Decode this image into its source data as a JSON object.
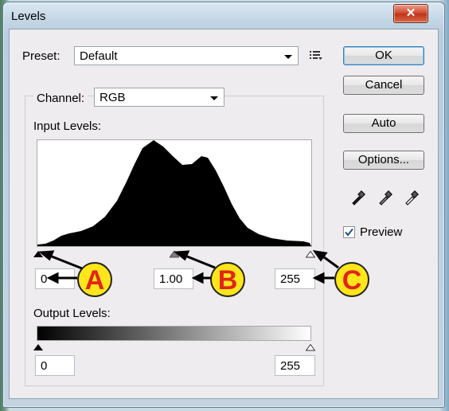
{
  "window": {
    "title": "Levels",
    "close_label": "✕"
  },
  "preset": {
    "label": "Preset:",
    "value": "Default",
    "menu_icon": "list-menu-icon"
  },
  "channel": {
    "label": "Channel:",
    "value": "RGB"
  },
  "input_levels": {
    "label": "Input Levels:",
    "black_point": "0",
    "gamma": "1.00",
    "white_point": "255"
  },
  "output_levels": {
    "label": "Output Levels:",
    "black_point": "0",
    "white_point": "255"
  },
  "buttons": {
    "ok": "OK",
    "cancel": "Cancel",
    "auto": "Auto",
    "options": "Options..."
  },
  "eyedroppers": [
    "black-eyedropper-icon",
    "gray-eyedropper-icon",
    "white-eyedropper-icon"
  ],
  "preview": {
    "label": "Preview",
    "checked": true
  },
  "callouts": [
    "A",
    "B",
    "C"
  ],
  "colors": {
    "callout_fill": "#ffe61a",
    "callout_text": "#e3231b",
    "accent": "#3c7fb1"
  }
}
